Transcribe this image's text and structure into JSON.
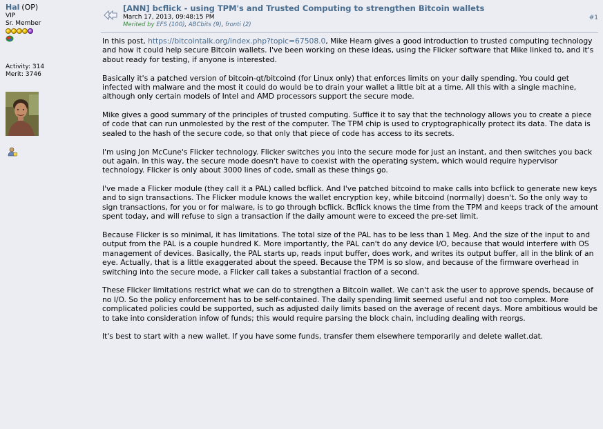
{
  "poster": {
    "name": "Hal",
    "op_tag": "(OP)",
    "rank1": "VIP",
    "rank2": "Sr. Member",
    "activity": "Activity: 314",
    "merit": "Merit: 3746"
  },
  "post": {
    "title": "[ANN] bcflick - using TPM's and Trusted Computing to strengthen Bitcoin wallets",
    "date": "March 17, 2013, 09:48:15 PM",
    "merited_prefix": "Merited by ",
    "merited_1": "EFS (100)",
    "merited_2": "ABCbits (9)",
    "merited_3": "fronti (2)",
    "sep": ", ",
    "post_number": "#1",
    "p1_a": "In this post, ",
    "p1_link": "https://bitcointalk.org/index.php?topic=67508.0",
    "p1_b": ", Mike Hearn gives a good introduction to trusted computing technology and how it could help secure Bitcoin wallets. I've been working on these ideas, using the Flicker software that Mike linked to, and it's about ready for testing, if anyone is interested.",
    "p2": "Basically it's a patched version of bitcoin-qt/bitcoind (for Linux only) that enforces limits on your daily spending. You could get infected with malware and the most it could do would be to drain your wallet a little bit at a time. All this with a single machine, although only certain models of Intel and AMD processors support the secure mode.",
    "p3": "Mike gives a good summary of the principles of trusted computing. Suffice it to say that the technology allows you to create a piece of code that can run unmolested by the rest of the computer. The TPM chip is used to cryptographically protect its data. The data is sealed to the hash of the secure code, so that only that piece of code has access to its secrets.",
    "p4": "I'm using Jon McCune's Flicker technology. Flicker switches you into the secure mode for just an instant, and then switches you back out again. In this way, the secure mode doesn't have to coexist with the operating system, which would require hypervisor technology. Flicker is only about 3000 lines of code, small as these things go.",
    "p5": "I've made a Flicker module (they call it a PAL) called bcflick. And I've patched bitcoind to make calls into bcflick to generate new keys and to sign transactions. The Flicker module knows the wallet encryption key, while bitcoind (normally) doesn't. So the only way to sign transactions, for you or for malware, is to go through bcflick. Bcflick knows the time from the TPM and keeps track of the amount spent today, and will refuse to sign a transaction if the daily amount were to exceed the pre-set limit.",
    "p6": "Because Flicker is so minimal, it has limitations. The total size of the PAL has to be less than 1 Meg. And the size of the input to and output from the PAL is a couple hundred K. More importantly, the PAL can't do any device I/O, because that would interfere with OS management of devices. Basically, the PAL starts up, reads input buffer, does work, and writes its output buffer, all in the blink of an eye. Actually, that is a little exaggerated about the speed. Because the TPM is so slow, and because of the firmware overhead in switching into the secure mode, a Flicker call takes a substantial fraction of a second.",
    "p7": "These Flicker limitations restrict what we can do to strengthen a Bitcoin wallet. We can't ask the user to approve spends, because of no I/O. So the policy enforcement has to be self-contained. The daily spending limit seemed useful and not too complex. More complicated policies could be supported, such as adjusted daily limits based on the average of recent days. More ambitious would be to take into consideration infow of funds; this would require parsing the block chain, including dealing with reorgs.",
    "p8": "It's best to start with a new wallet. If you have some funds, transfer them elsewhere temporarily and delete wallet.dat."
  },
  "colors": {
    "link": "#476c8e",
    "background": "#ecedf3",
    "merit": "#3c8d3c"
  },
  "icons": [
    "topic-icon",
    "star-icon",
    "flag-icon",
    "profile-icon"
  ]
}
